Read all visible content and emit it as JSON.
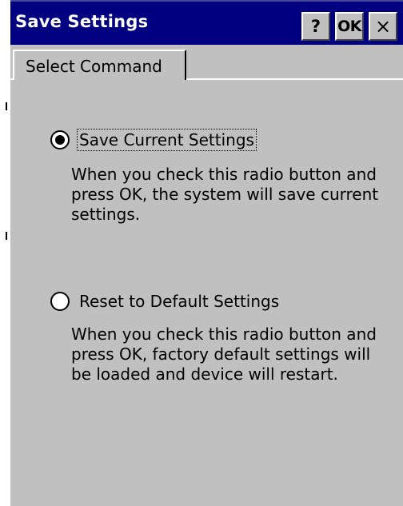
{
  "window": {
    "title": "Save Settings",
    "help_button": "?",
    "ok_button": "OK",
    "close_button": "×"
  },
  "tabs": [
    {
      "label": "Select Command",
      "selected": true
    }
  ],
  "options": [
    {
      "label": "Save Current Settings",
      "checked": true,
      "description": "When you check this radio button and press OK, the system will save current settings."
    },
    {
      "label": "Reset to Default Settings",
      "checked": false,
      "description": "When you check this radio button and press OK, factory default settings will be loaded and device will restart."
    }
  ],
  "colors": {
    "titlebar": "#000080",
    "face": "#c0c0c0"
  }
}
